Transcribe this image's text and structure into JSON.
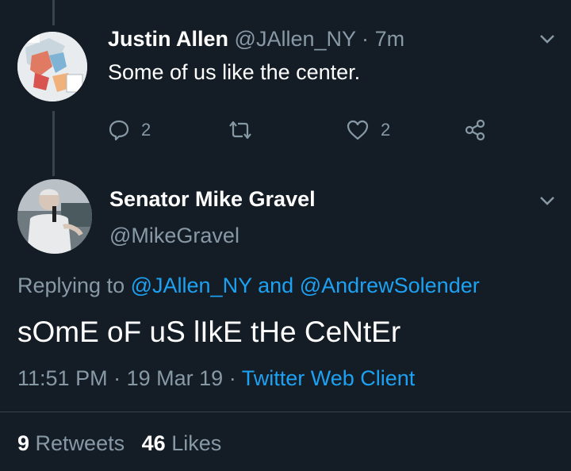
{
  "tweet1": {
    "name": "Justin Allen",
    "handle": "@JAllen_NY",
    "sep": "·",
    "time": "7m",
    "text": "Some of us like the center.",
    "reply_count": "2",
    "like_count": "2"
  },
  "tweet2": {
    "name": "Senator Mike Gravel",
    "handle": "@MikeGravel",
    "replying_prefix": "Replying to",
    "reply_to_1": "@JAllen_NY",
    "reply_and": "and",
    "reply_to_2": "@AndrewSolender",
    "text": "sOmE oF uS lIkE tHe CeNtEr",
    "time": "11:51 PM",
    "sep": "·",
    "date": "19 Mar 19",
    "sep2": "·",
    "client": "Twitter Web Client",
    "retweets_count": "9",
    "retweets_label": "Retweets",
    "likes_count": "46",
    "likes_label": "Likes"
  },
  "colors": {
    "background": "#141d26",
    "muted": "#8899a6",
    "link": "#1da1f2",
    "divider": "#38444d"
  },
  "icons": [
    "reply-icon",
    "retweet-icon",
    "like-icon",
    "share-icon",
    "chevron-down-icon"
  ]
}
